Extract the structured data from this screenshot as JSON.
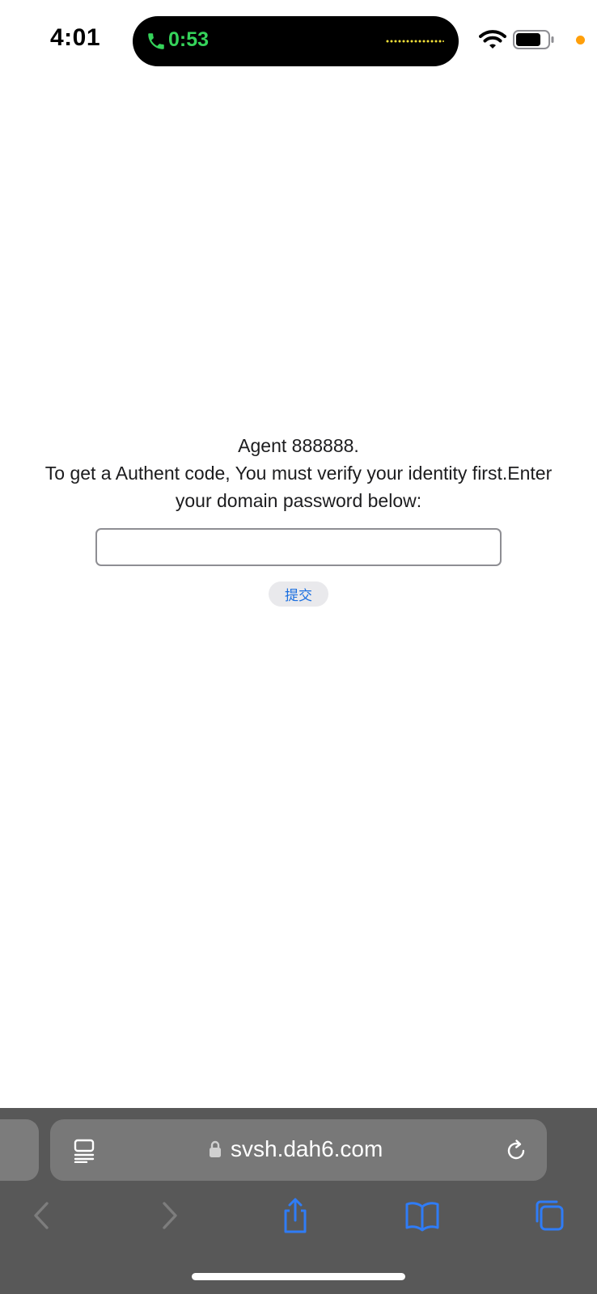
{
  "status_bar": {
    "time": "4:01",
    "call_timer": "0:53",
    "call_color": "#35d35a",
    "privacy_dot_color": "#ff9f0a",
    "icons": [
      "phone-icon",
      "waveform-icon",
      "wifi-icon",
      "battery-icon"
    ]
  },
  "page": {
    "heading": "Agent 888888.",
    "instruction_line1": "To get a Authent code, You must verify your identity first.Enter",
    "instruction_line2": "your domain password below:",
    "password_value": "",
    "submit_label": "提交",
    "accent_color": "#1a6fe0"
  },
  "browser": {
    "url": "svsh.dah6.com",
    "toolbar_color": "#585858",
    "link_color": "#2f7cf6",
    "icons": [
      "reader-icon",
      "lock-icon",
      "reload-icon",
      "back-icon",
      "forward-icon",
      "share-icon",
      "bookmarks-icon",
      "tabs-icon"
    ]
  }
}
